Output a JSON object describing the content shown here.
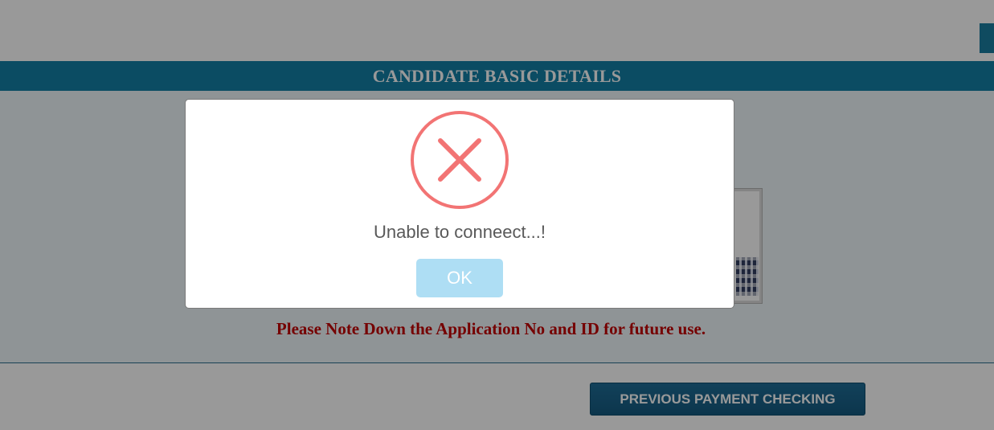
{
  "header": {
    "title": "CANDIDATE BASIC DETAILS"
  },
  "main": {
    "note": "Please Note Down the Application No and ID for future use."
  },
  "footer": {
    "previous_payment_label": "PREVIOUS PAYMENT CHECKING"
  },
  "dialog": {
    "icon": "error-x-icon",
    "message": "Unable to conneect...!",
    "ok_label": "OK"
  },
  "colors": {
    "header_bg": "#137fa6",
    "note_text": "#c30000",
    "button_bg": "#155a80",
    "error_icon": "#f27474",
    "ok_button": "#aedef4"
  }
}
